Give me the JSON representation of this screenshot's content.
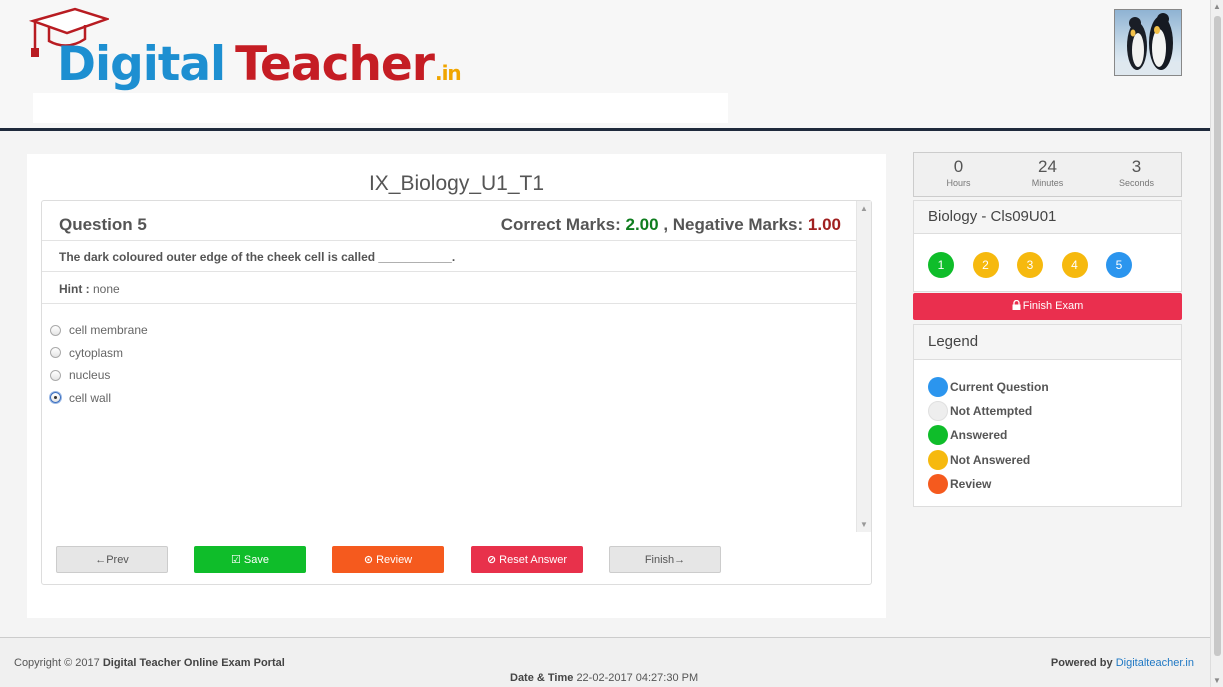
{
  "header": {
    "logo": {
      "word1": "Digital",
      "word2": "Teacher",
      "suffix": ".in"
    }
  },
  "exam": {
    "title": "IX_Biology_U1_T1",
    "question_label": "Question 5",
    "correct_marks_label": "Correct Marks:",
    "correct_marks": "2.00",
    "separator": ",",
    "negative_marks_label": "Negative Marks:",
    "negative_marks": "1.00",
    "question_text": "The dark coloured outer edge of the cheek cell is called ___________.",
    "hint_label": "Hint :",
    "hint_value": "none",
    "options": [
      {
        "label": "cell membrane",
        "selected": false
      },
      {
        "label": "cytoplasm",
        "selected": false
      },
      {
        "label": "nucleus",
        "selected": false
      },
      {
        "label": "cell wall",
        "selected": true
      }
    ]
  },
  "buttons": {
    "prev": "←Prev",
    "save": "Save",
    "review": "Review",
    "reset": "Reset Answer",
    "finish": "Finish→"
  },
  "timer": {
    "hours": "0",
    "hours_label": "Hours",
    "minutes": "24",
    "minutes_label": "Minutes",
    "seconds": "3",
    "seconds_label": "Seconds"
  },
  "subject": {
    "title": "Biology - Cls09U01",
    "questions": [
      {
        "num": "1",
        "color": "#0fbd2a"
      },
      {
        "num": "2",
        "color": "#f6b90e"
      },
      {
        "num": "3",
        "color": "#f6b90e"
      },
      {
        "num": "4",
        "color": "#f6b90e"
      },
      {
        "num": "5",
        "color": "#2b95ee"
      }
    ]
  },
  "finish_exam": "Finish Exam",
  "legend": {
    "title": "Legend",
    "items": [
      {
        "label": "Current Question",
        "color": "#2b95ee"
      },
      {
        "label": "Not Attempted",
        "color": "#eeeeee"
      },
      {
        "label": "Answered",
        "color": "#0fbd2a"
      },
      {
        "label": "Not Answered",
        "color": "#f6b90e"
      },
      {
        "label": "Review",
        "color": "#f55a1e"
      }
    ]
  },
  "footer": {
    "copyright": "Copyright © 2017",
    "portal": "Digital Teacher Online Exam Portal",
    "powered_by": "Powered by",
    "powered_link": "Digitalteacher.in",
    "date_label": "Date & Time",
    "date_value": "22-02-2017 04:27:30 PM"
  }
}
